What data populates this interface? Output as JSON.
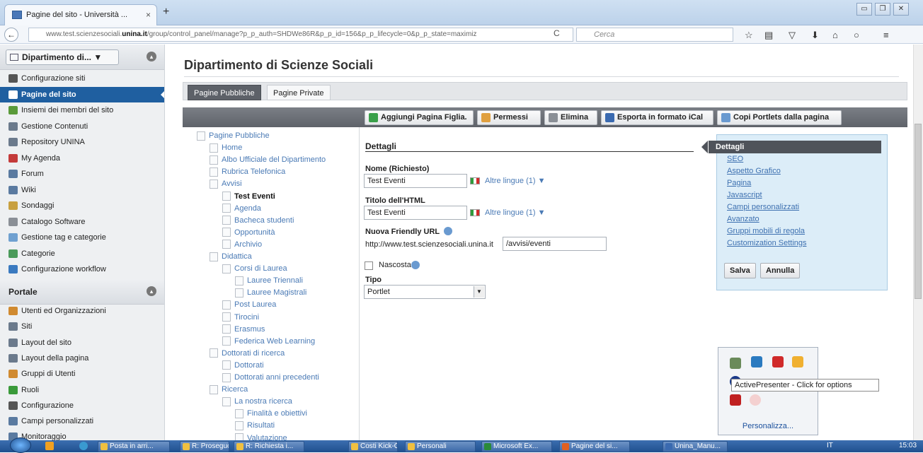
{
  "browser": {
    "tab_title": "Pagine del sito - Università ...",
    "tab_close": "×",
    "new_tab": "+",
    "url_prefix": "www.test.scienzesociali.",
    "url_domain": "unina.it",
    "url_rest": "/group/control_panel/manage?p_p_auth=SHDWe86R&p_p_id=156&p_p_lifecycle=0&p_p_state=maximiz",
    "search_placeholder": "Cerca",
    "reload": "C",
    "win_minimize": "▭",
    "win_restore": "❐",
    "win_close": "✕"
  },
  "sidebar": {
    "site_select": "Dipartimento di...",
    "site_items": [
      {
        "label": "Configurazione siti",
        "color": "#555555"
      },
      {
        "label": "Pagine del sito",
        "color": "#ffffff"
      },
      {
        "label": "Insiemi dei membri del sito",
        "color": "#5a9a3a"
      },
      {
        "label": "Gestione Contenuti",
        "color": "#6b7a8c"
      },
      {
        "label": "Repository UNINA",
        "color": "#6b7a8c"
      },
      {
        "label": "My Agenda",
        "color": "#c43a3a"
      },
      {
        "label": "Forum",
        "color": "#5a7aa0"
      },
      {
        "label": "Wiki",
        "color": "#5a7aa0"
      },
      {
        "label": "Sondaggi",
        "color": "#c8a040"
      },
      {
        "label": "Catalogo Software",
        "color": "#8a8f96"
      },
      {
        "label": "Gestione tag e categorie",
        "color": "#6fa0d0"
      },
      {
        "label": "Categorie",
        "color": "#4a9a5a"
      },
      {
        "label": "Configurazione workflow",
        "color": "#3a7ac0"
      }
    ],
    "portal_title": "Portale",
    "portal_items": [
      {
        "label": "Utenti ed Organizzazioni",
        "color": "#d08a30"
      },
      {
        "label": "Siti",
        "color": "#6b7a8c"
      },
      {
        "label": "Layout del sito",
        "color": "#6b7a8c"
      },
      {
        "label": "Layout della pagina",
        "color": "#6b7a8c"
      },
      {
        "label": "Gruppi di Utenti",
        "color": "#d08a30"
      },
      {
        "label": "Ruoli",
        "color": "#3a9a3a"
      },
      {
        "label": "Configurazione",
        "color": "#555555"
      },
      {
        "label": "Campi personalizzati",
        "color": "#5a7aa0"
      },
      {
        "label": "Monitoraggio",
        "color": "#5a7aa0"
      }
    ]
  },
  "main": {
    "page_title": "Dipartimento di Scienze Sociali",
    "tabs": [
      {
        "label": "Pagine Pubbliche"
      },
      {
        "label": "Pagine Private"
      }
    ],
    "toolbar": [
      {
        "label": "Aggiungi Pagina Figlia.",
        "color": "#3aa04a"
      },
      {
        "label": "Permessi",
        "color": "#e0a040"
      },
      {
        "label": "Elimina",
        "color": "#8a8f96"
      },
      {
        "label": "Esporta in formato iCal",
        "color": "#3a6ab0"
      },
      {
        "label": "Copi Portlets dalla pagina",
        "color": "#6a9ad0"
      }
    ]
  },
  "tree": [
    {
      "label": "Pagine Pubbliche",
      "level": 0,
      "current": false
    },
    {
      "label": "Home",
      "level": 1,
      "current": false
    },
    {
      "label": "Albo Ufficiale del Dipartimento",
      "level": 1,
      "current": false
    },
    {
      "label": "Rubrica Telefonica",
      "level": 1,
      "current": false
    },
    {
      "label": "Avvisi",
      "level": 1,
      "current": false
    },
    {
      "label": "Test Eventi",
      "level": 2,
      "current": true
    },
    {
      "label": "Agenda",
      "level": 2,
      "current": false
    },
    {
      "label": "Bacheca studenti",
      "level": 2,
      "current": false
    },
    {
      "label": "Opportunità",
      "level": 2,
      "current": false
    },
    {
      "label": "Archivio",
      "level": 2,
      "current": false
    },
    {
      "label": "Didattica",
      "level": 1,
      "current": false
    },
    {
      "label": "Corsi di Laurea",
      "level": 2,
      "current": false
    },
    {
      "label": "Lauree Triennali",
      "level": 3,
      "current": false
    },
    {
      "label": "Lauree Magistrali",
      "level": 3,
      "current": false
    },
    {
      "label": "Post Laurea",
      "level": 2,
      "current": false
    },
    {
      "label": "Tirocini",
      "level": 2,
      "current": false
    },
    {
      "label": "Erasmus",
      "level": 2,
      "current": false
    },
    {
      "label": "Federica Web Learning",
      "level": 2,
      "current": false
    },
    {
      "label": "Dottorati di ricerca",
      "level": 1,
      "current": false
    },
    {
      "label": "Dottorati",
      "level": 2,
      "current": false
    },
    {
      "label": "Dottorati anni precedenti",
      "level": 2,
      "current": false
    },
    {
      "label": "Ricerca",
      "level": 1,
      "current": false
    },
    {
      "label": "La nostra ricerca",
      "level": 2,
      "current": false
    },
    {
      "label": "Finalità e obiettivi",
      "level": 3,
      "current": false
    },
    {
      "label": "Risultati",
      "level": 3,
      "current": false
    },
    {
      "label": "Valutazione",
      "level": 3,
      "current": false
    }
  ],
  "details": {
    "heading": "Dettagli",
    "name_label": "Nome (Richiesto)",
    "name_value": "Test Eventi",
    "other_lang": "Altre lingue (1) ▼",
    "html_title_label": "Titolo dell'HTML",
    "html_title_value": "Test Eventi",
    "friendly_label": "Nuova Friendly URL",
    "friendly_prefix": "http://www.test.scienzesociali.unina.it",
    "friendly_value": "/avvisi/eventi",
    "hidden_label": "Nascosta",
    "type_label": "Tipo",
    "type_value": "Portlet"
  },
  "right_panel": {
    "active": "Dettagli",
    "links": [
      "SEO",
      "Aspetto Grafico",
      "Pagina",
      "Javascript",
      "Campi personalizzati",
      "Avanzato",
      "Gruppi mobili di regola",
      "Customization Settings"
    ],
    "save": "Salva",
    "cancel": "Annulla"
  },
  "tray": {
    "tooltip": "ActivePresenter - Click for options",
    "personalize": "Personalizza..."
  },
  "taskbar": {
    "items": [
      {
        "label": "Posta in arri...",
        "color": "#f0c040"
      },
      {
        "label": "R: Proseguo ...",
        "color": "#f0c040"
      },
      {
        "label": "R: Richiesta i...",
        "color": "#f0c040"
      },
      {
        "label": "Costi Kick-O...",
        "color": "#f0c040"
      },
      {
        "label": "Personali",
        "color": "#f0c040"
      },
      {
        "label": "Microsoft Ex...",
        "color": "#2a8a3a"
      },
      {
        "label": "Pagine del si...",
        "color": "#e06020"
      },
      {
        "label": "Unina_Manu...",
        "color": "#3a6ab0"
      }
    ],
    "lang": "IT",
    "clock": "15:03"
  }
}
